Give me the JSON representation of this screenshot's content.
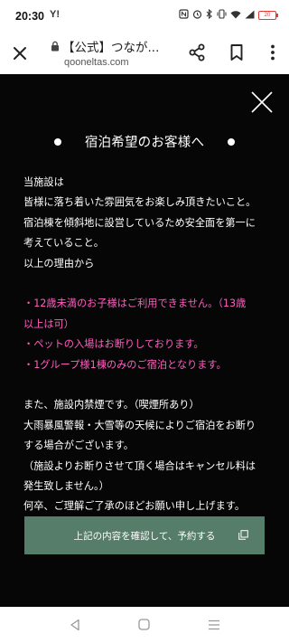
{
  "status_bar": {
    "time": "20:30",
    "carrier_mark": "Y!",
    "battery": "20",
    "icons": [
      "nfc-icon",
      "alarm-icon",
      "bluetooth-icon",
      "vibrate-icon",
      "wifi-icon",
      "signal-icon"
    ]
  },
  "browser": {
    "page_title": "【公式】つなが...",
    "url": "qooneltas.com"
  },
  "modal": {
    "heading": "宿泊希望のお客様へ",
    "body": {
      "intro": [
        "当施設は",
        "皆様に落ち着いた雰囲気をお楽しみ頂きたいこと。",
        "宿泊棟を傾斜地に設営しているため安全面を第一に",
        "考えていること。",
        "以上の理由から"
      ],
      "rules": [
        "・12歳未満のお子様はご利用できません。（13歳",
        "以上は可）",
        "・ペットの入場はお断りしております。",
        "・1グループ様1棟のみのご宿泊となります。"
      ],
      "notes": [
        "また、施設内禁煙です。（喫煙所あり）",
        "大雨暴風警報・大雪等の天候によりご宿泊をお断り",
        "する場合がございます。",
        "（施設よりお断りさせて頂く場合はキャンセル料は",
        "発生致しません。）",
        "何卒、ご理解ご了承のほどお願い申し上げます。"
      ]
    },
    "button_label": "上記の内容を確認して、予約する"
  },
  "colors": {
    "modal_bg": "#060606",
    "highlight": "#ff5fbf",
    "button_bg": "#567d69",
    "battery_low": "#e53935"
  }
}
